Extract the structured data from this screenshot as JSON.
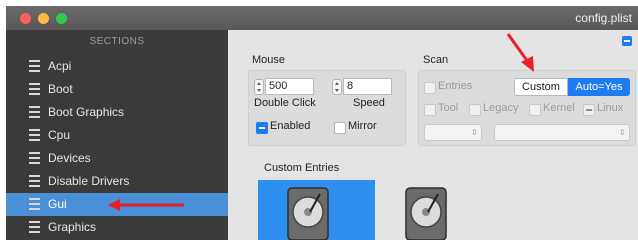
{
  "window": {
    "title": "config.plist"
  },
  "sidebar": {
    "header": "SECTIONS",
    "items": [
      {
        "label": "Acpi"
      },
      {
        "label": "Boot"
      },
      {
        "label": "Boot Graphics"
      },
      {
        "label": "Cpu"
      },
      {
        "label": "Devices"
      },
      {
        "label": "Disable Drivers"
      },
      {
        "label": "Gui"
      },
      {
        "label": "Graphics"
      }
    ],
    "selected": "Gui"
  },
  "mouse": {
    "title": "Mouse",
    "double_click_value": "500",
    "double_click_label": "Double Click",
    "speed_value": "8",
    "speed_label": "Speed",
    "enabled_label": "Enabled",
    "enabled_checked": true,
    "mirror_label": "Mirror",
    "mirror_checked": false
  },
  "scan": {
    "title": "Scan",
    "entries_label": "Entries",
    "custom_label": "Custom",
    "auto_label": "Auto=Yes",
    "tool_label": "Tool",
    "legacy_label": "Legacy",
    "kernel_label": "Kernel",
    "linux_label": "Linux"
  },
  "custom_entries": {
    "title": "Custom Entries"
  },
  "icons": {
    "close": "close-light-icon",
    "minimize": "minimize-light-icon",
    "zoom": "zoom-light-icon",
    "list": "list-icon",
    "disk": "hard-disk-icon",
    "arrow": "red-arrow-icon"
  },
  "colors": {
    "accent": "#1e7cf2",
    "sidebar": "#3a3a3a",
    "annotation": "#e8202a"
  }
}
